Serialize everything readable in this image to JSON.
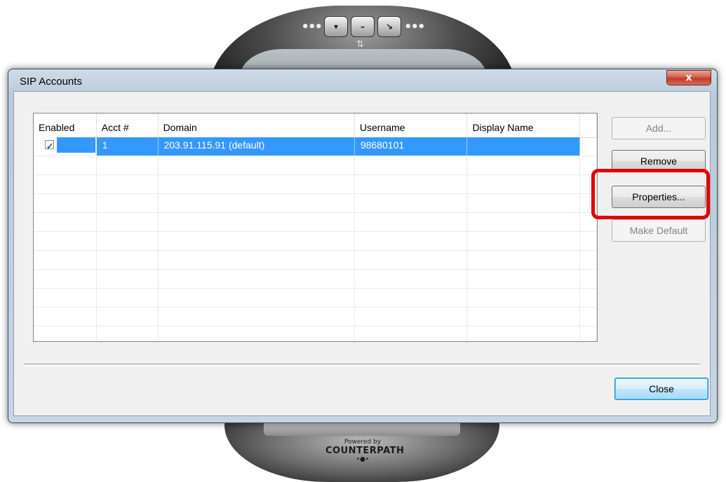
{
  "window": {
    "title": "SIP Accounts",
    "close_glyph": "x"
  },
  "list": {
    "columns": [
      "Enabled",
      "Acct #",
      "Domain",
      "Username",
      "Display Name"
    ],
    "rows": [
      {
        "enabled": true,
        "checkbox_glyph": "✓",
        "acct": "1",
        "domain": "203.91.115.91 (default)",
        "username": "98680101",
        "display_name": "",
        "selected": true
      }
    ]
  },
  "buttons": {
    "add": "Add...",
    "remove": "Remove",
    "properties": "Properties...",
    "make_default": "Make Default",
    "close": "Close"
  },
  "background_app": {
    "powered_by": "Powered by",
    "brand": "COUNTERPATH"
  },
  "colors": {
    "selection": "#3399ff",
    "highlight_annotation": "#e30000",
    "title_bar": "#b9cadb"
  }
}
